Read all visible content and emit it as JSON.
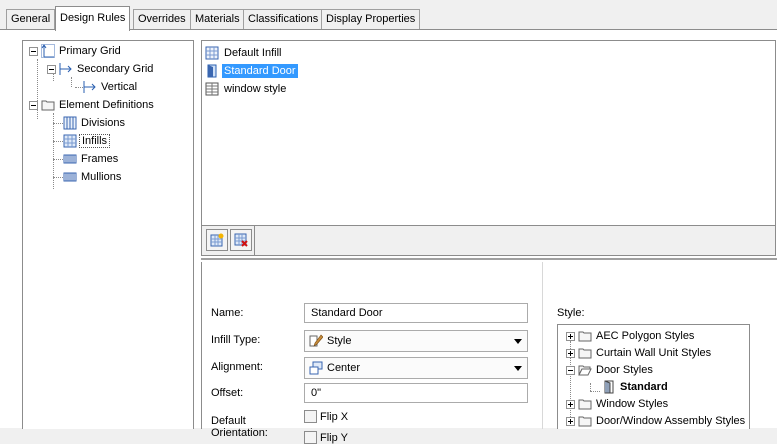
{
  "tabs": [
    "General",
    "Design Rules",
    "Overrides",
    "Materials",
    "Classifications",
    "Display Properties"
  ],
  "active_tab": "Design Rules",
  "left_tree": {
    "items": [
      "Primary Grid",
      "Secondary Grid",
      "Vertical",
      "Element Definitions",
      "Divisions",
      "Infills",
      "Frames",
      "Mullions"
    ],
    "selected": "Infills"
  },
  "infill_list": {
    "items": [
      "Default Infill",
      "Standard Door",
      "window style"
    ],
    "selected": "Standard Door"
  },
  "toolbar": {
    "add_icon": "new-infill-icon",
    "delete_icon": "delete-infill-icon"
  },
  "props": {
    "name_label": "Name:",
    "name_value": "Standard Door",
    "infill_type_label": "Infill Type:",
    "infill_type_value": "Style",
    "alignment_label": "Alignment:",
    "alignment_value": "Center",
    "offset_label": "Offset:",
    "offset_value": "0\"",
    "orientation_label_1": "Default",
    "orientation_label_2": "Orientation:",
    "flip_x": "Flip X",
    "flip_y": "Flip Y"
  },
  "style": {
    "label": "Style:",
    "items": [
      "AEC Polygon Styles",
      "Curtain Wall Unit Styles",
      "Door Styles",
      "Standard",
      "Window Styles",
      "Door/Window Assembly Styles"
    ],
    "selected": "Standard"
  },
  "colors": {
    "selection": "#3399ff",
    "border": "#8c8c8c",
    "background": "#f0f0f0"
  }
}
